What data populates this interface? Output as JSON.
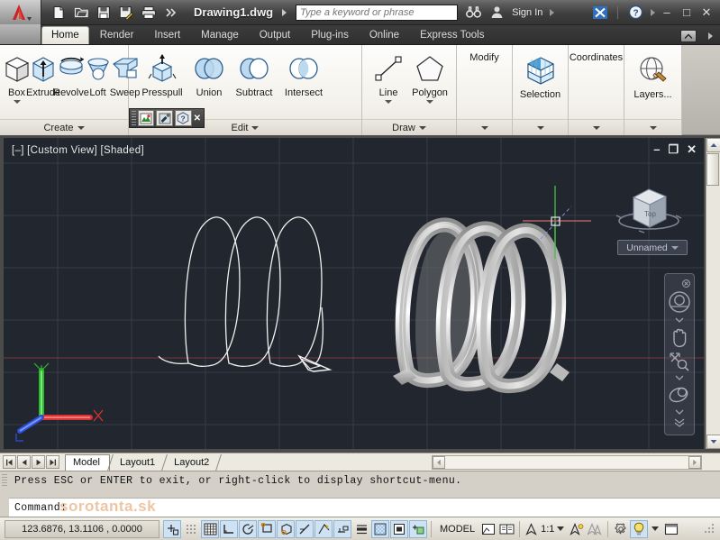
{
  "titlebar": {
    "app_menu": "A-logo",
    "quick_access": [
      {
        "name": "new-icon",
        "tip": "New"
      },
      {
        "name": "open-icon",
        "tip": "Open"
      },
      {
        "name": "save-icon",
        "tip": "Save"
      },
      {
        "name": "saveas-icon",
        "tip": "Save As"
      },
      {
        "name": "plot-icon",
        "tip": "Plot"
      },
      {
        "name": "more-icon",
        "tip": "More"
      }
    ],
    "document_title": "Drawing1.dwg",
    "search_placeholder": "Type a keyword or phrase",
    "search_value": "",
    "binoculars_icon": "search-binoculars-icon",
    "sign_in": "Sign In",
    "exchange_icon": "autodesk-exchange-icon",
    "help_icon": "help-icon",
    "minimize": "–",
    "maximize": "□",
    "close": "✕"
  },
  "ribbon": {
    "tabs": [
      {
        "label": "Home",
        "active": true
      },
      {
        "label": "Render",
        "active": false
      },
      {
        "label": "Insert",
        "active": false
      },
      {
        "label": "Manage",
        "active": false
      },
      {
        "label": "Output",
        "active": false
      },
      {
        "label": "Plug-ins",
        "active": false
      },
      {
        "label": "Online",
        "active": false
      },
      {
        "label": "Express Tools",
        "active": false
      }
    ],
    "panels": [
      {
        "title": "Create",
        "tools": [
          {
            "label": "Box",
            "icon": "box-icon",
            "dropdown": true
          },
          {
            "label": "Extrude",
            "icon": "extrude-icon",
            "dropdown": false
          },
          {
            "label": "Revolve",
            "icon": "revolve-icon",
            "dropdown": false
          },
          {
            "label": "Loft",
            "icon": "loft-icon",
            "dropdown": false
          },
          {
            "label": "Sweep",
            "icon": "sweep-icon",
            "dropdown": false
          }
        ]
      },
      {
        "title": "Edit",
        "tools": [
          {
            "label": "Presspull",
            "icon": "presspull-icon",
            "dropdown": false
          },
          {
            "label": "Union",
            "icon": "union-icon",
            "dropdown": false
          },
          {
            "label": "Subtract",
            "icon": "subtract-icon",
            "dropdown": false
          },
          {
            "label": "Intersect",
            "icon": "intersect-icon",
            "dropdown": false
          }
        ]
      },
      {
        "title": "Draw",
        "tools": [
          {
            "label": "Line",
            "icon": "line-icon",
            "dropdown": true
          },
          {
            "label": "Polygon",
            "icon": "polygon-icon",
            "dropdown": true
          }
        ]
      },
      {
        "title": "",
        "header": "Modify",
        "tools": []
      },
      {
        "title": "",
        "header": "",
        "tools": [
          {
            "label": "Selection",
            "icon": "selection-cube-icon",
            "dropdown": false
          }
        ]
      },
      {
        "title": "",
        "header": "Coordinates",
        "tools": []
      },
      {
        "title": "",
        "header": "",
        "tools": [
          {
            "label": "Layers...",
            "icon": "layers-icon",
            "dropdown": false
          }
        ]
      }
    ],
    "minimize_ribbon_icon": "ribbon-minimize-icon"
  },
  "mini_toolbar": {
    "buttons": [
      {
        "name": "render-preview-icon"
      },
      {
        "name": "materials-icon"
      },
      {
        "name": "help-query-icon"
      }
    ],
    "close": "✕"
  },
  "viewport": {
    "label": "[–] [Custom View] [Shaded]",
    "controls": {
      "minimize": "–",
      "restore": "❐",
      "close": "✕"
    },
    "viewcube_face": "Top",
    "view_name": "Unnamed",
    "background": "#22262e",
    "nav_bar": [
      {
        "name": "steering-wheel-icon"
      },
      {
        "name": "pan-hand-icon"
      },
      {
        "name": "zoom-icon"
      },
      {
        "name": "orbit-icon"
      },
      {
        "name": "more-nav-icon"
      }
    ],
    "objects": [
      {
        "name": "helix-wireframe",
        "type": "helix",
        "turns": 3,
        "style": "wireframe"
      },
      {
        "name": "swept-solid-coil",
        "type": "swept-solid",
        "turns": 3,
        "style": "shaded"
      }
    ],
    "ucs_axes": [
      {
        "axis": "X",
        "color": "#e03030"
      },
      {
        "axis": "Y",
        "color": "#34c034"
      },
      {
        "axis": "Z",
        "color": "#3050e0"
      }
    ]
  },
  "layout_tabs": {
    "nav": [
      "⏮",
      "◀",
      "▶",
      "⏭"
    ],
    "tabs": [
      {
        "label": "Model",
        "active": true
      },
      {
        "label": "Layout1",
        "active": false
      },
      {
        "label": "Layout2",
        "active": false
      }
    ]
  },
  "command_line": {
    "history": "Press ESC or ENTER to exit, or right-click to display shortcut-menu.",
    "prompt": "Command:",
    "input_value": ""
  },
  "watermark": "sorotanta.sk",
  "status_bar": {
    "coordinates": "123.6876, 13.1106 , 0.0000",
    "toggles": [
      {
        "name": "snap-mode-icon",
        "on": true
      },
      {
        "name": "grid-display-icon",
        "on": false
      },
      {
        "name": "grid-mode-icon",
        "on": true
      },
      {
        "name": "ortho-mode-icon",
        "on": true
      },
      {
        "name": "polar-tracking-icon",
        "on": true
      },
      {
        "name": "object-snap-icon",
        "on": true
      },
      {
        "name": "3d-object-snap-icon",
        "on": true
      },
      {
        "name": "object-snap-tracking-icon",
        "on": true
      },
      {
        "name": "dynamic-ucs-icon",
        "on": true
      },
      {
        "name": "dynamic-input-icon",
        "on": true
      },
      {
        "name": "lineweight-icon",
        "on": false
      },
      {
        "name": "transparency-icon",
        "on": true
      },
      {
        "name": "quick-properties-icon",
        "on": true
      },
      {
        "name": "selection-cycling-icon",
        "on": true
      }
    ],
    "model_label": "MODEL",
    "space_buttons": [
      {
        "name": "quick-view-layouts-icon"
      },
      {
        "name": "quick-view-drawings-icon"
      }
    ],
    "annotation_scale": "1:1",
    "annotation_buttons": [
      {
        "name": "annotation-visibility-icon"
      },
      {
        "name": "auto-scale-icon"
      }
    ],
    "right_buttons": [
      {
        "name": "workspace-gear-icon"
      },
      {
        "name": "hardware-acceleration-icon"
      },
      {
        "name": "toolbar-lock-icon"
      },
      {
        "name": "clean-screen-icon"
      }
    ],
    "resize_grip": "resize-grip-icon"
  }
}
